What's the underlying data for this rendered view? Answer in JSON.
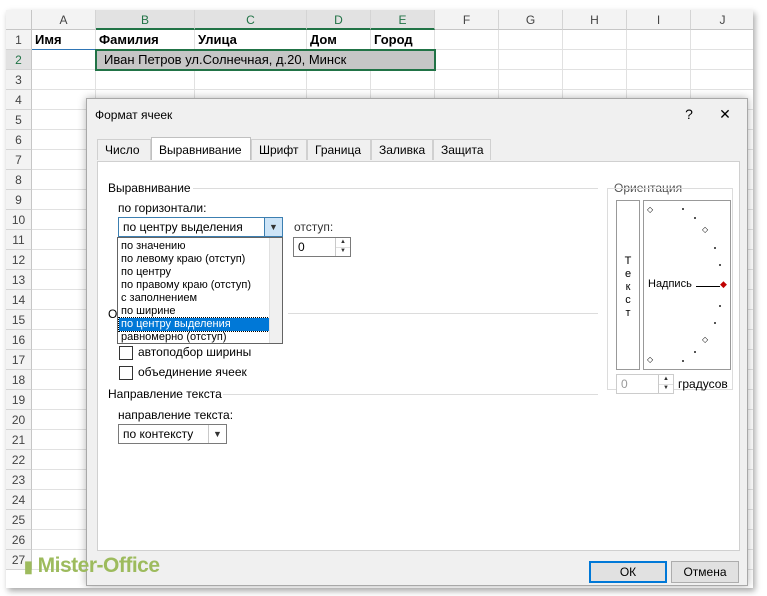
{
  "columns": [
    "A",
    "B",
    "C",
    "D",
    "E",
    "F",
    "G",
    "H",
    "I",
    "J"
  ],
  "rows": [
    "1",
    "2",
    "3",
    "4",
    "5",
    "6",
    "7",
    "8",
    "9",
    "10",
    "11",
    "12",
    "13",
    "14",
    "15",
    "16",
    "17",
    "18",
    "19",
    "20",
    "21",
    "22",
    "23",
    "24",
    "25",
    "26",
    "27"
  ],
  "row1": {
    "a": "Имя",
    "b": "Фамилия",
    "c": "Улица",
    "d": "Дом",
    "e": "Город"
  },
  "row2_text": "Иван Петров ул.Солнечная, д.20, Минск",
  "dialog": {
    "title": "Формат ячеек",
    "help": "?",
    "close": "✕",
    "tabs": [
      "Число",
      "Выравнивание",
      "Шрифт",
      "Граница",
      "Заливка",
      "Защита"
    ],
    "alignment_group": "Выравнивание",
    "horizontal_label": "по горизонтали:",
    "horizontal_value": "по центру выделения",
    "indent_label": "отступ:",
    "indent_value": "0",
    "dropdown_options": [
      "по значению",
      "по левому краю (отступ)",
      "по центру",
      "по правому краю (отступ)",
      "с заполнением",
      "по ширине",
      "по центру выделения",
      "равномерно (отступ)"
    ],
    "display_group_partial": "О",
    "autofit_label": "автоподбор ширины",
    "merge_label": "объединение ячеек",
    "direction_group": "Направление текста",
    "direction_label": "направление текста:",
    "direction_value": "по контексту",
    "orientation_group": "Ориентация",
    "vertical_text": [
      "Т",
      "е",
      "к",
      "с",
      "т"
    ],
    "orientation_label": "Надпись",
    "degrees_value": "0",
    "degrees_label": "градусов",
    "ok": "ОК",
    "cancel": "Отмена"
  },
  "watermark": "Mister-Office",
  "colors": {
    "excel_green": "#217346",
    "highlight": "#0078d7",
    "selection_fill": "#c6c6c6",
    "watermark": "#9dbb5d"
  }
}
